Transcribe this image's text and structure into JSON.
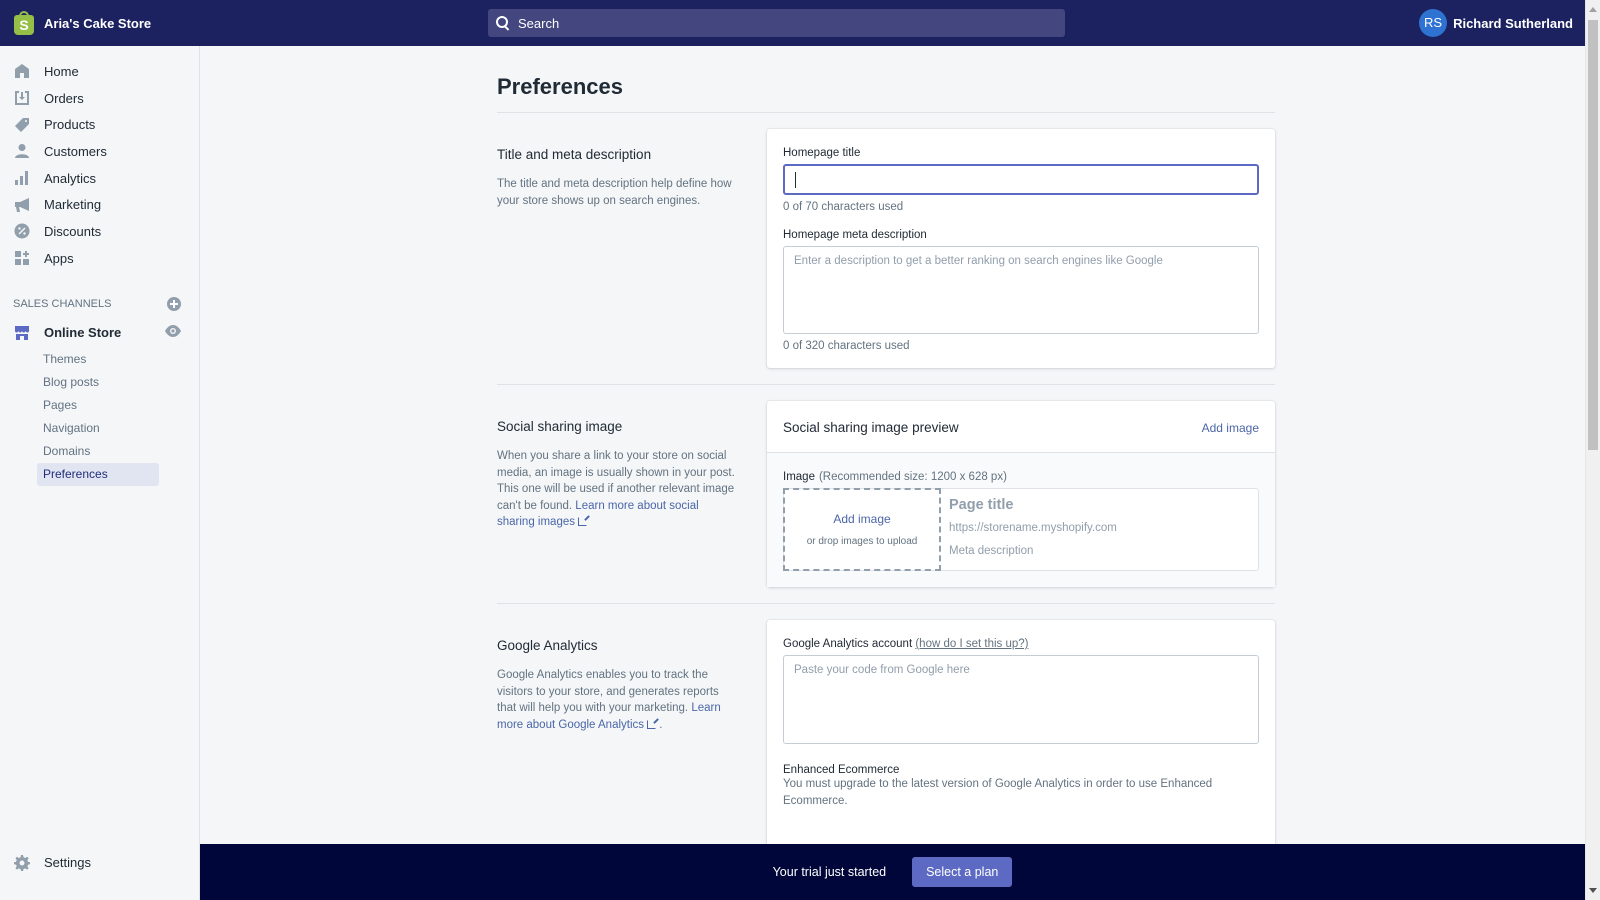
{
  "topbar": {
    "store_name": "Aria's Cake Store",
    "search_placeholder": "Search",
    "user_initials": "RS",
    "user_name": "Richard Sutherland"
  },
  "sidebar": {
    "items": [
      {
        "label": "Home",
        "icon": "home-icon"
      },
      {
        "label": "Orders",
        "icon": "orders-icon"
      },
      {
        "label": "Products",
        "icon": "tag-icon"
      },
      {
        "label": "Customers",
        "icon": "person-icon"
      },
      {
        "label": "Analytics",
        "icon": "bar-chart-icon"
      },
      {
        "label": "Marketing",
        "icon": "megaphone-icon"
      },
      {
        "label": "Discounts",
        "icon": "discount-icon"
      },
      {
        "label": "Apps",
        "icon": "apps-icon"
      }
    ],
    "sales_channels_label": "SALES CHANNELS",
    "online_store_label": "Online Store",
    "sub_items": [
      "Themes",
      "Blog posts",
      "Pages",
      "Navigation",
      "Domains",
      "Preferences"
    ],
    "active_sub_item": "Preferences",
    "settings_label": "Settings"
  },
  "page": {
    "title": "Preferences",
    "title_meta": {
      "heading": "Title and meta description",
      "description": "The title and meta description help define how your store shows up on search engines.",
      "homepage_title_label": "Homepage title",
      "homepage_title_value": "",
      "homepage_title_help": "0 of 70 characters used",
      "meta_desc_label": "Homepage meta description",
      "meta_desc_placeholder": "Enter a description to get a better ranking on search engines like Google",
      "meta_desc_help": "0 of 320 characters used"
    },
    "social": {
      "heading": "Social sharing image",
      "description": "When you share a link to your store on social media, an image is usually shown in your post. This one will be used if another relevant image can't be found.",
      "learn_more": "Learn more about social sharing images",
      "card_title": "Social sharing image preview",
      "add_image_link": "Add image",
      "image_label": "Image",
      "image_hint": "(Recommended size: 1200 x 628 px)",
      "dropzone_add": "Add image",
      "dropzone_sub": "or drop images to upload",
      "preview_title": "Page title",
      "preview_url": "https://storename.myshopify.com",
      "preview_meta": "Meta description"
    },
    "analytics": {
      "heading": "Google Analytics",
      "description": "Google Analytics enables you to track the visitors to your store, and generates reports that will help you with your marketing.",
      "learn_more": "Learn more about Google Analytics",
      "trailing": ".",
      "account_label": "Google Analytics account",
      "account_help_link": "(how do I set this up?)",
      "code_placeholder": "Paste your code from Google here",
      "ee_title": "Enhanced Ecommerce",
      "ee_desc": "You must upgrade to the latest version of Google Analytics in order to use Enhanced Ecommerce."
    }
  },
  "footer": {
    "trial_text": "Your trial just started",
    "select_plan": "Select a plan"
  },
  "colors": {
    "topbar": "#1c2260",
    "accent": "#5c6ac4",
    "footer": "#000639",
    "brand_logo": "#95bf47"
  }
}
